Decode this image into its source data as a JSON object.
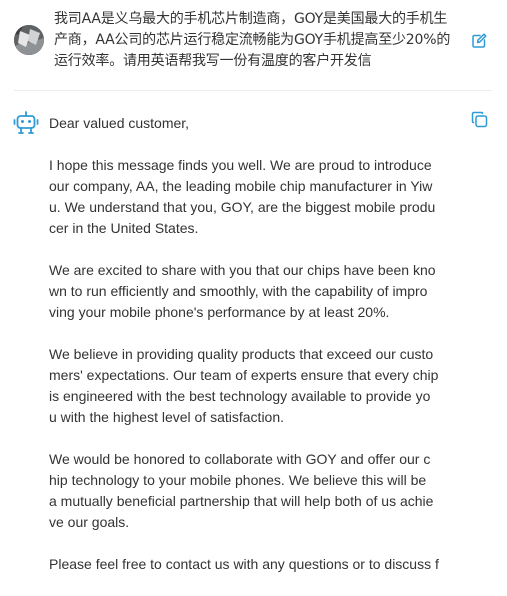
{
  "user_message": {
    "lines": [
      "我司AA是义乌最大的手机芯片制造商，GOY是美国最大的手机生",
      "产商，AA公司的芯片运行稳定流畅能为GOY手机提高至少20%的",
      "运行效率。请用英语帮我写一份有温度的客户开发信"
    ]
  },
  "assistant_reply": {
    "greeting": "Dear valued customer,",
    "paragraphs": [
      {
        "lines": [
          "I hope this message finds you well. We are proud to introduce",
          "our company, AA, the leading mobile chip manufacturer in Yiw",
          "u. We understand that you, GOY, are the biggest mobile produ",
          "cer in the United States."
        ]
      },
      {
        "lines": [
          "We are excited to share with you that our chips have been kno",
          "wn to run efficiently and smoothly, with the capability of impro",
          "ving your mobile phone's performance by at least 20%."
        ]
      },
      {
        "lines": [
          "We believe in providing quality products that exceed our custo",
          "mers' expectations. Our team of experts ensure that every chip",
          "is engineered with the best technology available to provide yo",
          "u with the highest level of satisfaction."
        ]
      },
      {
        "lines": [
          "We would be honored to collaborate with GOY and offer our c",
          "hip technology to your mobile phones. We believe this will be",
          "a mutually beneficial partnership that will help both of us achie",
          "ve our goals."
        ]
      },
      {
        "lines": [
          "Please feel free to contact us with any questions or to discuss f"
        ]
      }
    ]
  },
  "icons": {
    "edit": "edit-icon",
    "copy": "copy-icon",
    "bot": "robot-icon",
    "avatar": "user-avatar"
  },
  "colors": {
    "accent": "#2f9bd6",
    "text": "#333333",
    "divider": "#ededed"
  }
}
